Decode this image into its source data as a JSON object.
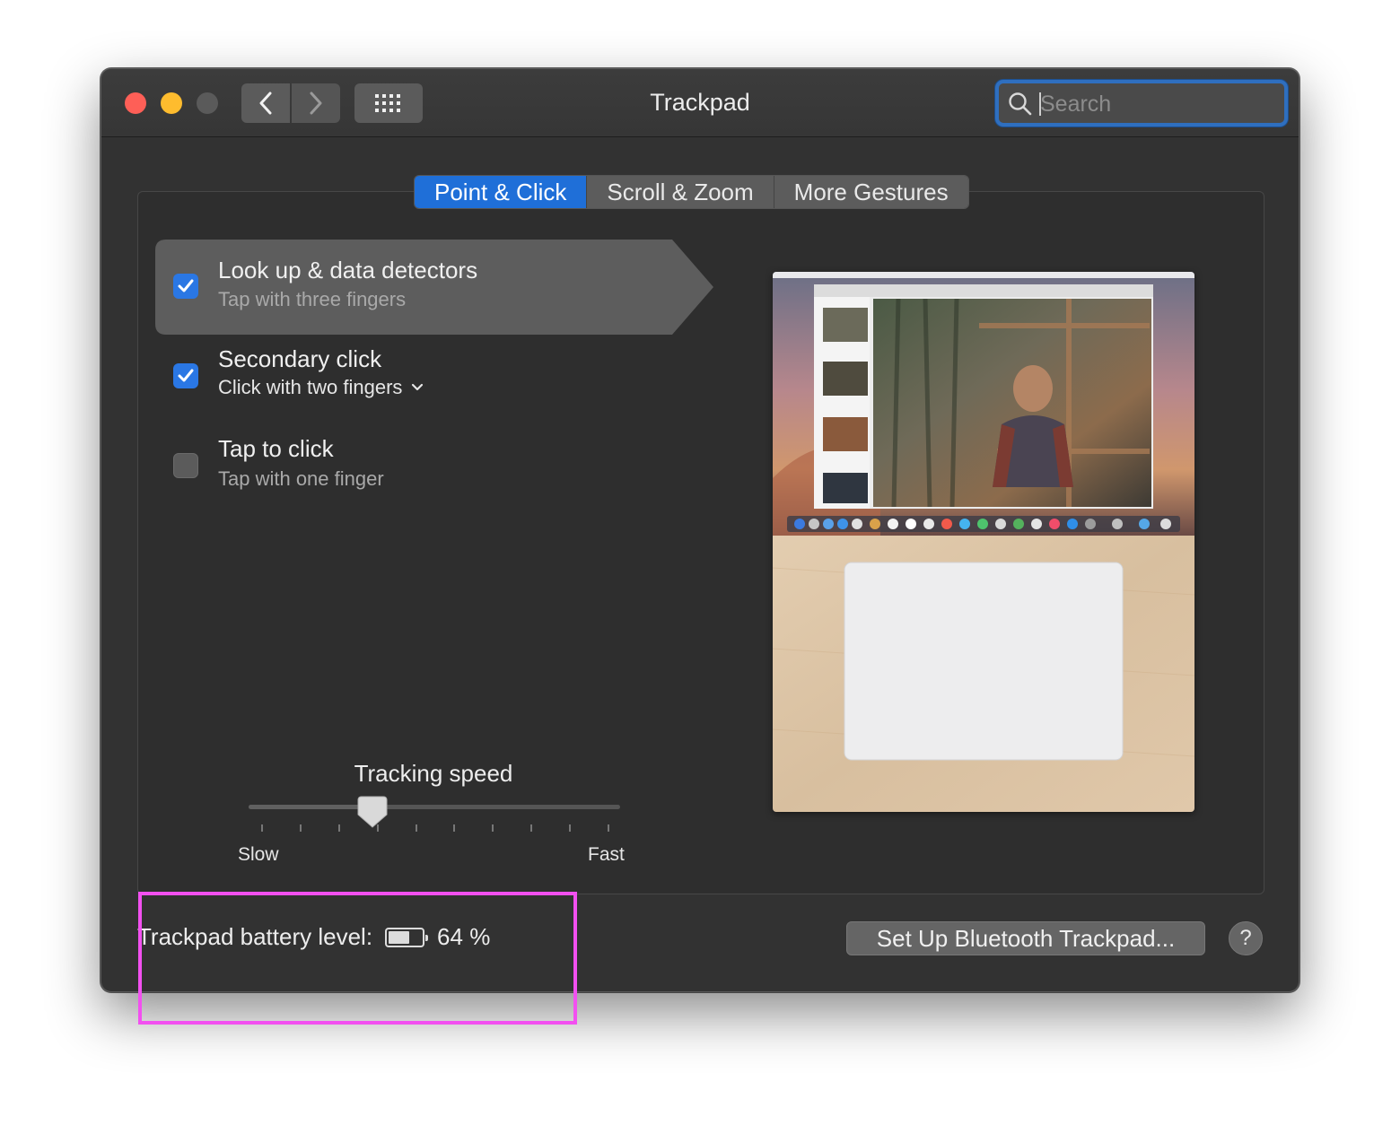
{
  "window": {
    "title": "Trackpad"
  },
  "search": {
    "placeholder": "Search",
    "value": ""
  },
  "tabs": [
    {
      "label": "Point & Click",
      "active": true
    },
    {
      "label": "Scroll & Zoom",
      "active": false
    },
    {
      "label": "More Gestures",
      "active": false
    }
  ],
  "options": [
    {
      "title": "Look up & data detectors",
      "subtitle": "Tap with three fingers",
      "checked": true,
      "selected": true
    },
    {
      "title": "Secondary click",
      "subtitle": "Click with two fingers",
      "checked": true,
      "selected": false,
      "has_popup": true
    },
    {
      "title": "Tap to click",
      "subtitle": "Tap with one finger",
      "checked": false,
      "selected": false
    }
  ],
  "tracking": {
    "title": "Tracking speed",
    "min_label": "Slow",
    "max_label": "Fast",
    "value_fraction": 0.333,
    "tick_count": 10
  },
  "battery": {
    "label": "Trackpad battery level:",
    "percent_text": "64 %",
    "level_fraction": 0.64
  },
  "buttons": {
    "bluetooth_setup": "Set Up Bluetooth Trackpad...",
    "help": "?"
  },
  "icons": {
    "back": "chevron-left-icon",
    "forward": "chevron-right-icon",
    "grid": "show-all-grid-icon",
    "search": "magnifier-icon",
    "checkmark": "checkmark-icon",
    "popup": "chevron-down-icon",
    "battery": "battery-icon"
  },
  "colors": {
    "accent": "#1f6fd8",
    "highlight": "#f250f0",
    "window_bg": "#323232"
  }
}
